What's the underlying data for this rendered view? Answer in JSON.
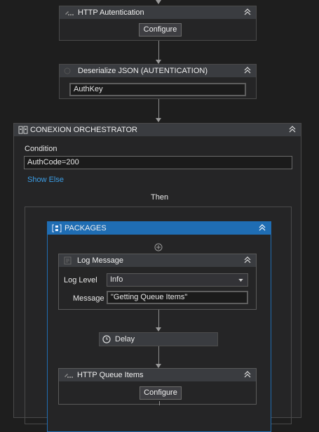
{
  "http_auth": {
    "title": "HTTP Autentication",
    "configure": "Configure"
  },
  "deserialize": {
    "title": "Deserialize JSON (AUTENTICATION)",
    "value": "AuthKey"
  },
  "orchestrator": {
    "title": "CONEXION ORCHESTRATOR",
    "condition_label": "Condition",
    "condition_value": "AuthCode=200",
    "show_else": "Show Else",
    "then_label": "Then"
  },
  "packages": {
    "title": "PACKAGES"
  },
  "log_message": {
    "title": "Log Message",
    "log_level_label": "Log Level",
    "log_level_value": "Info",
    "message_label": "Message",
    "message_value": "\"Getting Queue Items\""
  },
  "delay": {
    "title": "Delay"
  },
  "http_queue": {
    "title": "HTTP Queue Items",
    "configure": "Configure"
  },
  "colors": {
    "accent": "#1f6db3",
    "link": "#3c9ee6",
    "background": "#1e1e1e"
  },
  "icons": [
    "http-icon",
    "deserialize-icon",
    "orchestrator-icon",
    "packages-icon",
    "log-icon",
    "delay-icon",
    "collapse-icon",
    "add-icon",
    "dropdown-icon"
  ]
}
